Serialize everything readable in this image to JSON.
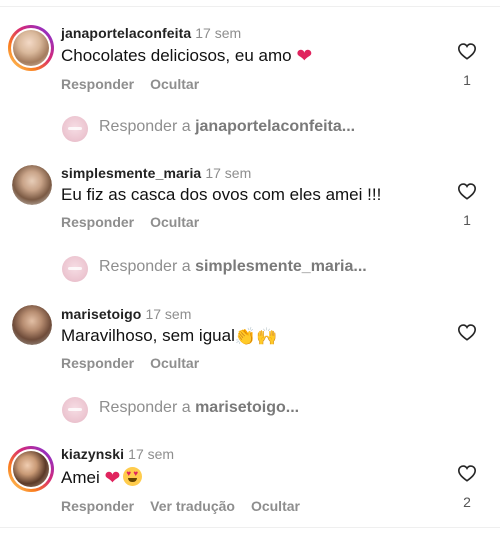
{
  "colors": {
    "username": "#222222",
    "meta": "#8e8e8e",
    "heart_emoji": "#e0245e",
    "story_ring": [
      "#feda75",
      "#fa7e1e",
      "#d62976",
      "#962fbf"
    ]
  },
  "comments": [
    {
      "username": "janaportelaconfeita",
      "time": "17 sem",
      "text": "Chocolates deliciosos, eu amo",
      "emoji": "red-heart",
      "likes": "1",
      "actions": [
        "Responder",
        "Ocultar"
      ],
      "has_story_ring": true
    },
    {
      "username": "simplesmente_maria",
      "time": "17 sem",
      "text": "Eu fiz  as casca dos ovos com eles amei !!!",
      "likes": "1",
      "actions": [
        "Responder",
        "Ocultar"
      ],
      "has_story_ring": false
    },
    {
      "username": "marisetoigo",
      "time": "17 sem",
      "text": "Maravilhoso, sem igual",
      "emoji": "clapping-raised-hands",
      "likes": "",
      "actions": [
        "Responder",
        "Ocultar"
      ],
      "has_story_ring": false
    },
    {
      "username": "kiazynski",
      "time": "17 sem",
      "text": "Amei",
      "emoji": "heart-heart-eyes",
      "likes": "2",
      "actions": [
        "Responder",
        "Ver tradução",
        "Ocultar"
      ],
      "has_story_ring": true
    }
  ],
  "reply_rows": [
    {
      "prefix": "Responder a",
      "target": "janaportelaconfeita..."
    },
    {
      "prefix": "Responder a",
      "target": "simplesmente_maria..."
    },
    {
      "prefix": "Responder a",
      "target": "marisetoigo..."
    }
  ]
}
